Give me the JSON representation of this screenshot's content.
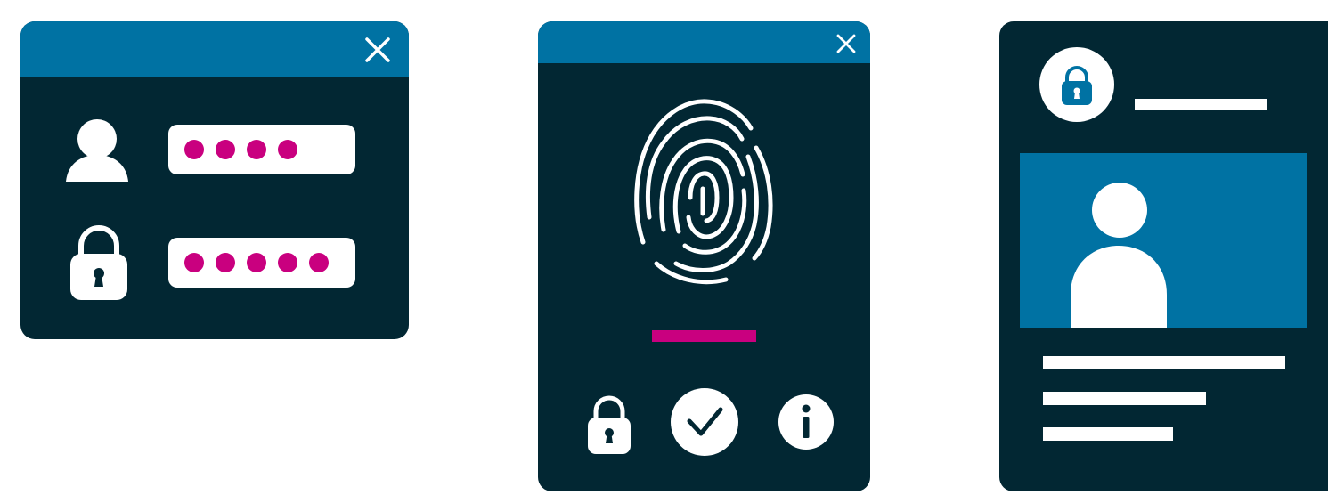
{
  "colors": {
    "navy": "#022733",
    "blue": "#0072A3",
    "magenta": "#C9007F",
    "white": "#FFFFFF"
  },
  "login_card": {
    "close_icon": "close-icon",
    "username_icon": "user-icon",
    "password_icon": "lock-icon",
    "username_masked_dots": 4,
    "password_masked_dots": 5
  },
  "fingerprint_card": {
    "close_icon": "close-icon",
    "scan_icon": "fingerprint-icon",
    "scan_progress": 1.0,
    "buttons": [
      "lock-icon",
      "check-icon",
      "info-icon"
    ]
  },
  "profile_card": {
    "badge_icon": "lock-icon",
    "photo_icon": "user-icon"
  }
}
